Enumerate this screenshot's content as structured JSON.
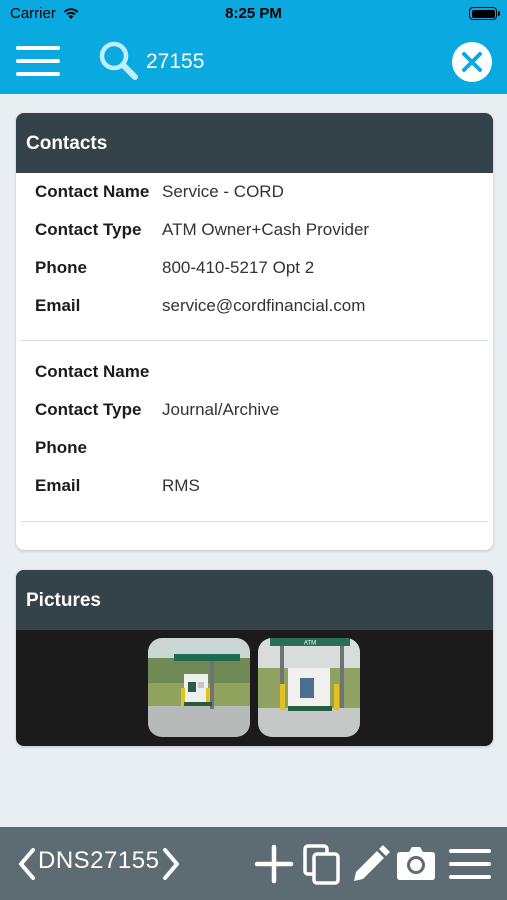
{
  "status_bar": {
    "carrier": "Carrier",
    "time": "8:25 PM",
    "wifi_icon": "wifi-icon",
    "battery_icon": "battery-icon"
  },
  "header": {
    "menu_icon": "hamburger-menu-icon",
    "search_icon": "search-icon",
    "search_value": "27155",
    "clear_icon": "close-icon",
    "background_color": "#0aa9df"
  },
  "contacts": {
    "title": "Contacts",
    "entries": [
      {
        "fields": [
          {
            "label": "Contact Name",
            "value": "Service - CORD"
          },
          {
            "label": "Contact Type",
            "value": "ATM Owner+Cash Provider"
          },
          {
            "label": "Phone",
            "value": "800-410-5217 Opt 2"
          },
          {
            "label": "Email",
            "value": "service@cordfinancial.com"
          }
        ]
      },
      {
        "fields": [
          {
            "label": "Contact Name",
            "value": ""
          },
          {
            "label": "Contact Type",
            "value": "Journal/Archive"
          },
          {
            "label": "Phone",
            "value": ""
          },
          {
            "label": "Email",
            "value": "RMS"
          }
        ]
      }
    ]
  },
  "pictures": {
    "title": "Pictures",
    "thumbnails": [
      "atm-photo-thumbnail",
      "atm-photo-thumbnail"
    ],
    "thumbnail_1_sign": "",
    "thumbnail_2_sign": "ATM"
  },
  "bottom_bar": {
    "record_id": "DNS27155",
    "prev_icon": "chevron-left-icon",
    "next_icon": "chevron-right-icon",
    "tools": [
      "add-icon",
      "copy-icon",
      "edit-pencil-icon",
      "camera-icon",
      "list-menu-icon"
    ],
    "background_color": "#5d6b72"
  },
  "colors": {
    "card_header": "#344249",
    "page_background": "#e9eef3"
  }
}
